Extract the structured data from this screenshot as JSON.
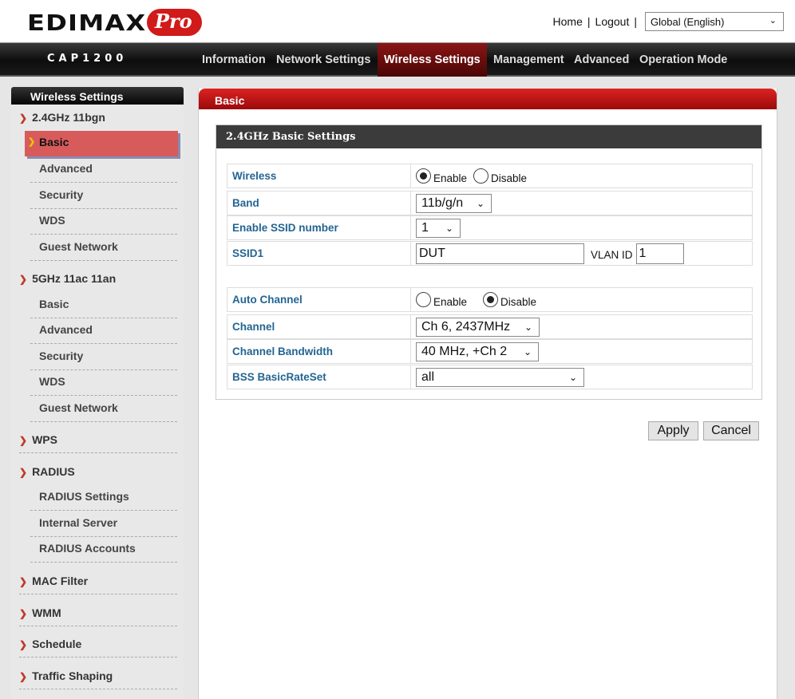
{
  "header": {
    "logo_brand": "EDIMAX",
    "logo_suffix": "Pro",
    "links": {
      "home": "Home",
      "logout": "Logout",
      "sep": "|"
    },
    "language": {
      "selected": "Global (English)"
    }
  },
  "nav": {
    "model": "CAP1200",
    "items": [
      {
        "label": "Information"
      },
      {
        "label": "Network Settings"
      },
      {
        "label": "Wireless Settings"
      },
      {
        "label": "Management"
      },
      {
        "label": "Advanced"
      },
      {
        "label": "Operation Mode"
      }
    ]
  },
  "sidebar": {
    "title": "Wireless Settings",
    "groups": {
      "g24": "2.4GHz 11bgn",
      "g5": "5GHz 11ac 11an",
      "wps": "WPS",
      "radius": "RADIUS",
      "mac": "MAC Filter",
      "wmm": "WMM",
      "schedule": "Schedule",
      "traffic": "Traffic Shaping"
    },
    "g24_items": [
      "Basic",
      "Advanced",
      "Security",
      "WDS",
      "Guest Network"
    ],
    "g5_items": [
      "Basic",
      "Advanced",
      "Security",
      "WDS",
      "Guest Network"
    ],
    "radius_items": [
      "RADIUS Settings",
      "Internal Server",
      "RADIUS Accounts"
    ]
  },
  "main": {
    "title": "Basic",
    "panel_title": "2.4GHz Basic Settings",
    "wireless": {
      "label": "Wireless",
      "enable": "Enable",
      "disable": "Disable"
    },
    "band": {
      "label": "Band",
      "value": "11b/g/n"
    },
    "ssid_number": {
      "label": "Enable SSID number",
      "value": "1"
    },
    "ssid1": {
      "label": "SSID1",
      "value": "DUT",
      "vlan_label": "VLAN ID",
      "vlan_value": "1"
    },
    "auto_channel": {
      "label": "Auto Channel",
      "enable": "Enable",
      "disable": "Disable"
    },
    "channel": {
      "label": "Channel",
      "value": "Ch 6, 2437MHz"
    },
    "bandwidth": {
      "label": "Channel Bandwidth",
      "value": "40 MHz, +Ch 2"
    },
    "bss": {
      "label": "BSS BasicRateSet",
      "value": "all"
    },
    "apply": "Apply",
    "cancel": "Cancel"
  }
}
